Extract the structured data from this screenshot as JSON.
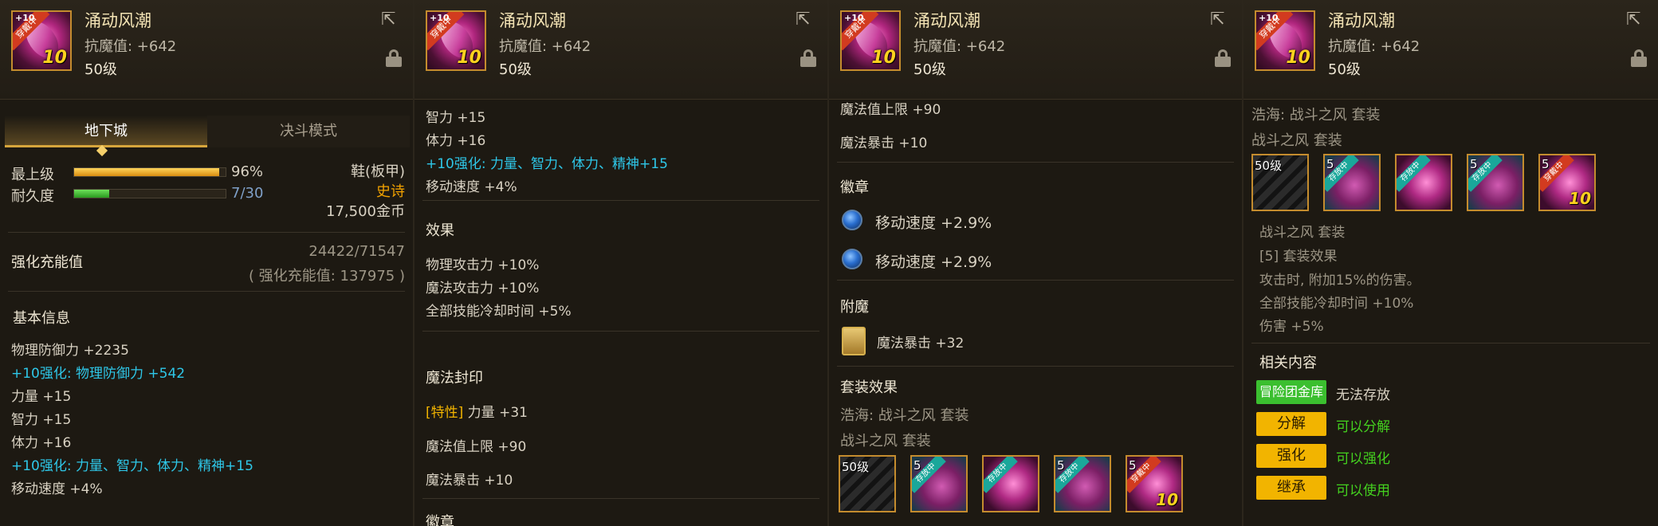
{
  "item": {
    "name": "涌动风潮",
    "stat": "抗魔值: +642",
    "level": "50级",
    "ribbon": "穿戴中",
    "upgrade_mark": "+10",
    "icon_num": "10"
  },
  "panel1": {
    "tabs": [
      "地下城",
      "决斗模式"
    ],
    "grade_label": "最上级",
    "grade_value": "96%",
    "grade_fraction": 0.96,
    "durability_label": "耐久度",
    "durability_value": "7/30",
    "durability_fraction": 0.2333,
    "type": "鞋(板甲)",
    "rarity": "史诗",
    "price": "17,500金币",
    "charge_label": "强化充能值",
    "charge_value": "24422/71547",
    "charge_sub": "( 强化充能值: 137975 )",
    "basic_info": "基本信息",
    "lines": [
      {
        "text": "物理防御力 +2235",
        "cyan": false
      },
      {
        "text": "+10强化: 物理防御力 +542",
        "cyan": true
      },
      {
        "text": "力量 +15",
        "cyan": false
      },
      {
        "text": "智力 +15",
        "cyan": false
      },
      {
        "text": "体力 +16",
        "cyan": false
      },
      {
        "text": "+10强化: 力量、智力、体力、精神+15",
        "cyan": true
      },
      {
        "text": "移动速度 +4%",
        "cyan": false
      }
    ]
  },
  "panel2": {
    "lines_top": [
      {
        "text": "智力 +15",
        "cyan": false
      },
      {
        "text": "体力 +16",
        "cyan": false
      },
      {
        "text": "+10强化: 力量、智力、体力、精神+15",
        "cyan": true
      },
      {
        "text": "移动速度 +4%",
        "cyan": false
      }
    ],
    "effect_title": "效果",
    "effects": [
      "物理攻击力 +10%",
      "魔法攻击力 +10%",
      "全部技能冷却时间 +5%"
    ],
    "seal_title": "魔法封印",
    "seal_trait": "[特性]",
    "seal_trait_rest": " 力量 +31",
    "seal_lines": [
      "魔法值上限 +90",
      "魔法暴击 +10"
    ],
    "emblem_title": "徽章"
  },
  "panel3": {
    "lines_top": [
      "魔法值上限 +90",
      "魔法暴击 +10"
    ],
    "emblem_title": "徽章",
    "emblems": [
      "移动速度 +2.9%",
      "移动速度 +2.9%"
    ],
    "enchant_title": "附魔",
    "enchant": "魔法暴击 +32",
    "set_title": "套装效果",
    "set_line1": "浩海: 战斗之风 套装",
    "set_line2": "战斗之风 套装",
    "set_items": [
      {
        "style": "dark",
        "label": "50级",
        "tag": "",
        "ten": ""
      },
      {
        "style": "teal",
        "label": "5",
        "tag": "存放中",
        "ten": ""
      },
      {
        "style": "pink",
        "label": "",
        "tag": "存放中",
        "ten": ""
      },
      {
        "style": "teal",
        "label": "5",
        "tag": "存放中",
        "ten": ""
      },
      {
        "style": "pink",
        "label": "5",
        "tag": "穿戴中",
        "ten": "10"
      }
    ]
  },
  "panel4": {
    "set_line1": "浩海: 战斗之风 套装",
    "set_line2": "战斗之风 套装",
    "set_items": [
      {
        "style": "dark",
        "label": "50级",
        "tag": "",
        "ten": ""
      },
      {
        "style": "teal",
        "label": "5",
        "tag": "存放中",
        "ten": ""
      },
      {
        "style": "pink",
        "label": "",
        "tag": "存放中",
        "ten": ""
      },
      {
        "style": "teal",
        "label": "5",
        "tag": "存放中",
        "ten": ""
      },
      {
        "style": "pink",
        "label": "5",
        "tag": "穿戴中",
        "ten": "10"
      }
    ],
    "set_name": "战斗之风 套装",
    "set_effect_title": "[5] 套装效果",
    "set_effects": [
      "攻击时, 附加15%的伤害。",
      "全部技能冷却时间 +10%",
      "伤害 +5%"
    ],
    "related_title": "相关内容",
    "actions": [
      {
        "button": "冒险团金库",
        "desc": "无法存放",
        "green_btn": true,
        "desc_green": false
      },
      {
        "button": "分解",
        "desc": "可以分解",
        "green_btn": false,
        "desc_green": true
      },
      {
        "button": "强化",
        "desc": "可以强化",
        "green_btn": false,
        "desc_green": true
      },
      {
        "button": "继承",
        "desc": "可以使用",
        "green_btn": false,
        "desc_green": true
      }
    ]
  },
  "colors": {
    "cyan": "#2ec7e8",
    "gold": "#f2b400",
    "green": "#44d11f",
    "epic": "#f2a200"
  }
}
